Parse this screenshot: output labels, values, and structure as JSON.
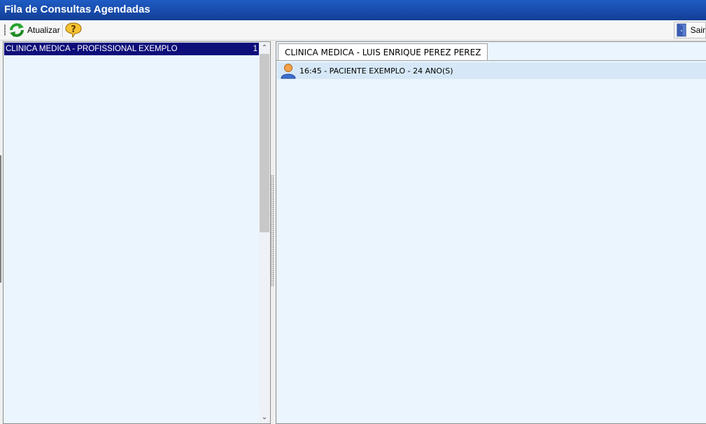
{
  "window": {
    "title": "Fila de Consultas Agendadas"
  },
  "toolbar": {
    "refresh_label": "Atualizar",
    "refresh_icon": "refresh-icon",
    "help_icon": "help-icon",
    "exit_label": "Sair",
    "exit_icon": "exit-door-icon"
  },
  "left_list": {
    "items": [
      {
        "label": "CLINICA MEDICA - PROFISSIONAL EXEMPLO",
        "count": "1"
      }
    ]
  },
  "right_panel": {
    "tab_label": "CLINICA MEDICA - LUIS ENRIQUE PEREZ PEREZ",
    "patients": [
      {
        "text": "16:45 - PACIENTE EXEMPLO - 24 ANO(S)",
        "icon": "person-icon"
      }
    ]
  },
  "colors": {
    "title_bar": "#1f5cc4",
    "selected_item": "#0e0e7a",
    "panel_bg": "#ebf5fd",
    "row_bg": "#d6e8f7"
  }
}
